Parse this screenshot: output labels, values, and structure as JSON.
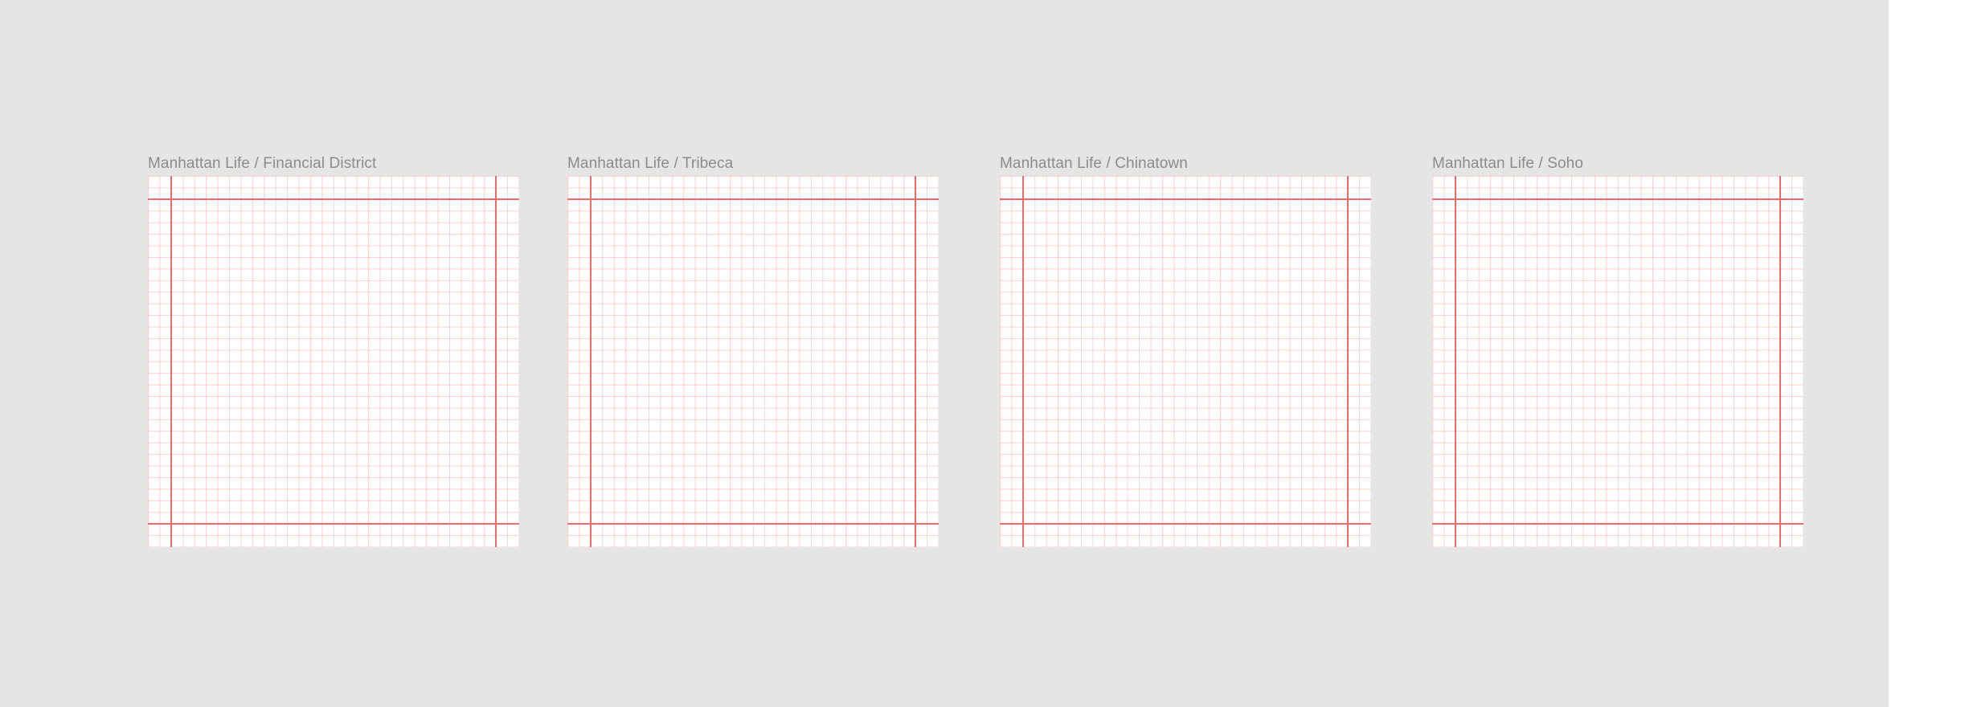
{
  "canvas": {
    "background_color": "#e5e5e5",
    "grid_color": "#ff8787",
    "guide_color": "#f06a6a"
  },
  "frames": [
    {
      "label": "Manhattan Life / Financial District"
    },
    {
      "label": "Manhattan Life / Tribeca"
    },
    {
      "label": "Manhattan Life / Chinatown"
    },
    {
      "label": "Manhattan Life / Soho"
    }
  ]
}
